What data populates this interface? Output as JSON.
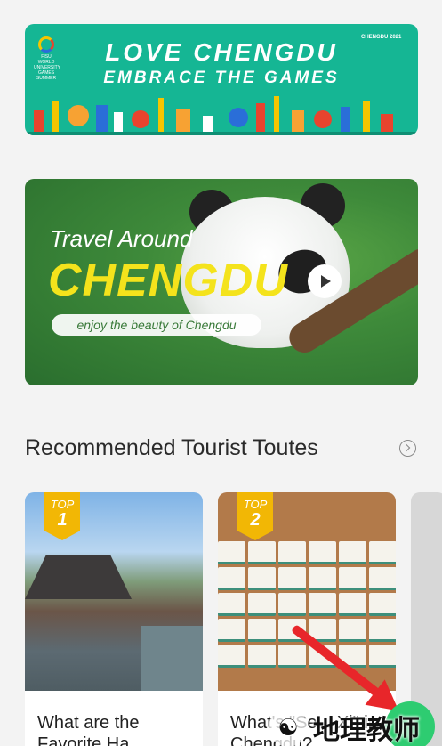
{
  "banner": {
    "line1": "LOVE  CHENGDU",
    "line2": "EMBRACE THE GAMES",
    "logo_left": "FISU WORLD UNIVERSITY GAMES SUMMER",
    "logo_right": "CHENGDU 2021"
  },
  "hero": {
    "line1": "Travel Around",
    "line2": "CHENGDU",
    "tagline": "enjoy the beauty of Chengdu"
  },
  "section": {
    "title": "Recommended Tourist Toutes"
  },
  "cards": [
    {
      "badge_top": "TOP",
      "badge_num": "1",
      "caption": "What are the Favorite Ha..."
    },
    {
      "badge_top": "TOP",
      "badge_num": "2",
      "caption": "What's \"Se... Xi\" in Chengdu?"
    }
  ],
  "watermark": {
    "text": "地理教师"
  },
  "colors": {
    "banner_bg": "#15b694",
    "accent_yellow": "#f4e31c",
    "badge": "#f2b705",
    "annotation_arrow": "#e8262a"
  }
}
